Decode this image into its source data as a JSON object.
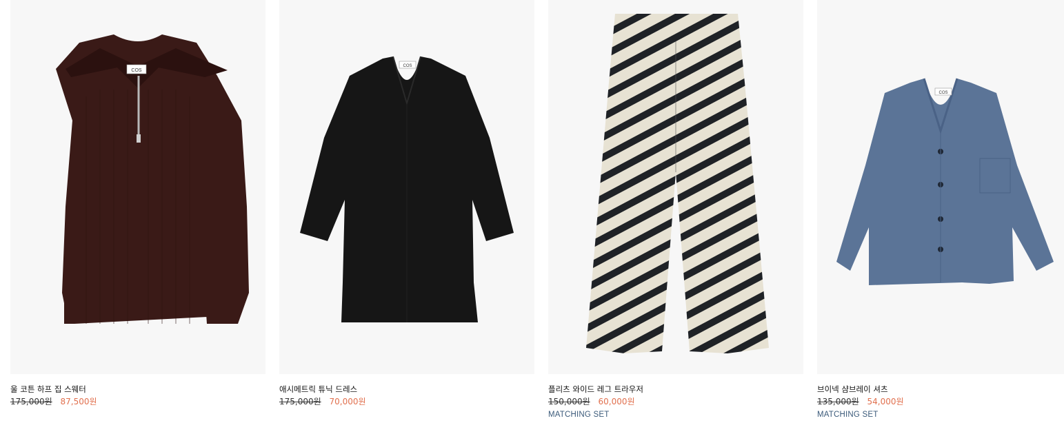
{
  "products": [
    {
      "name": "울 코튼 하프 집 스웨터",
      "original_price": "175,000원",
      "sale_price": "87,500원",
      "tag": "",
      "image": "half-zip-sweater-image",
      "color": "#3a1a17"
    },
    {
      "name": "애시메트릭 튜닉 드레스",
      "original_price": "175,000원",
      "sale_price": "70,000원",
      "tag": "",
      "image": "tunic-dress-image",
      "color": "#161616"
    },
    {
      "name": "플리츠 와이드 레그 트라우저",
      "original_price": "150,000원",
      "sale_price": "60,000원",
      "tag": "MATCHING SET",
      "image": "pleated-trouser-image",
      "color": "#1f2226"
    },
    {
      "name": "브이넥 샴브레이 셔츠",
      "original_price": "135,000원",
      "sale_price": "54,000원",
      "tag": "MATCHING SET",
      "image": "chambray-shirt-image",
      "color": "#5b7497"
    }
  ],
  "colors": {
    "sale": "#e1704e",
    "tag": "#3b5a7a",
    "image_background": "#f7f7f7"
  }
}
